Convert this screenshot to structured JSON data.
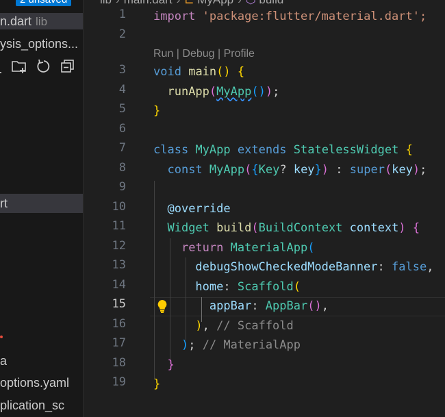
{
  "sidebar": {
    "badge": "2 unsaved",
    "file_row_1": {
      "name": "n.dart",
      "suffix": "lib"
    },
    "file_row_2": "ysis_options...",
    "selected_row": "rt",
    "row_a": "a",
    "row_options": "options.yaml",
    "row_application": "plication_sc"
  },
  "breadcrumb": {
    "item1": "lib",
    "item2": "main.dart",
    "item3": "MyApp",
    "item4": "build"
  },
  "codelens": "Run | Debug | Profile",
  "line_numbers": [
    "1",
    "2",
    "3",
    "4",
    "5",
    "6",
    "7",
    "8",
    "9",
    "10",
    "11",
    "12",
    "13",
    "14",
    "15",
    "16",
    "17",
    "18",
    "19"
  ],
  "active_line": "15",
  "code": {
    "l1": {
      "kw": "import",
      "str": "'package:flutter/material.dart';"
    },
    "l3": {
      "type": "void",
      "fn": "main",
      "p": "()",
      "brace": "{"
    },
    "l4": {
      "fn": "runApp",
      "open": "(",
      "cls": "MyApp",
      "inner": "()",
      "close": ")",
      "semi": ";"
    },
    "l5": {
      "brace": "}"
    },
    "l7": {
      "kw": "class",
      "cls": "MyApp",
      "kw2": "extends",
      "cls2": "StatelessWidget",
      "brace": "{"
    },
    "l8": {
      "kw": "const",
      "cls": "MyApp",
      "open": "(",
      "b2": "{",
      "type": "Key",
      "q": "?",
      "var": "key",
      "b2c": "}",
      "close": ")",
      "colon": " : ",
      "kw2": "super",
      "open2": "(",
      "var2": "key",
      "close2": ")",
      "semi": ";"
    },
    "l10": {
      "ann": "@override"
    },
    "l11": {
      "cls": "Widget",
      "fn": "build",
      "open": "(",
      "cls2": "BuildContext",
      "var": "context",
      "close": ")",
      "brace": "{"
    },
    "l12": {
      "ctl": "return",
      "cls": "MaterialApp",
      "open": "("
    },
    "l13": {
      "var": "debugShowCheckedModeBanner",
      "colon": ": ",
      "kw": "false",
      "comma": ","
    },
    "l14": {
      "var": "home",
      "colon": ": ",
      "cls": "Scaffold",
      "open": "("
    },
    "l15": {
      "var": "appBar",
      "colon": ": ",
      "cls": "AppBar",
      "parens": "()",
      "comma": ","
    },
    "l16": {
      "close": ")",
      "comma": ",",
      "cmt": "// Scaffold"
    },
    "l17": {
      "close": ")",
      "semi": ";",
      "cmt": "// MaterialApp"
    },
    "l18": {
      "brace": "}"
    },
    "l19": {
      "brace": "}"
    }
  },
  "colors": {
    "keyword": "#569cd6",
    "control": "#c586c0",
    "string": "#ce9178",
    "function": "#dcdcaa",
    "class": "#4ec9b0",
    "variable": "#9cdcfe",
    "accent": "#0078d4"
  },
  "icons": {
    "toolbar": [
      "new-folder-icon",
      "refresh-icon",
      "collapse-all-icon"
    ],
    "gutter": "lightbulb-icon"
  }
}
